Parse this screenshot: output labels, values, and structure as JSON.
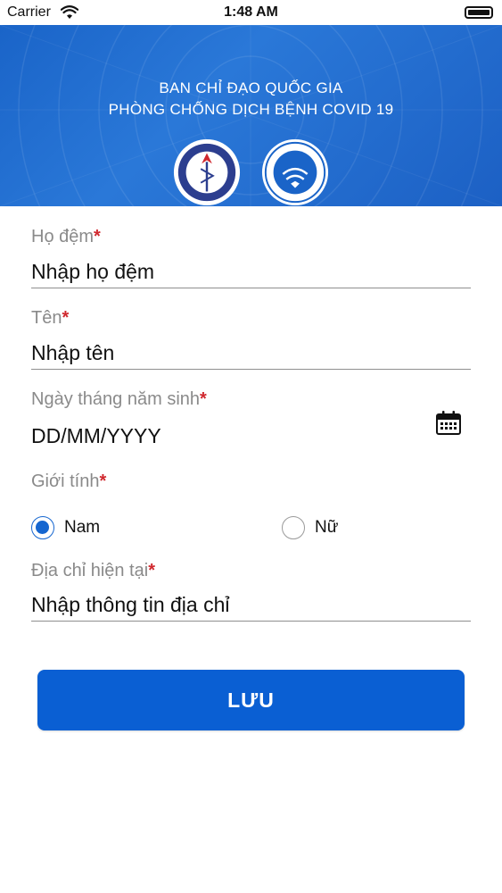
{
  "status_bar": {
    "carrier": "Carrier",
    "time": "1:48 AM"
  },
  "header": {
    "line1": "BAN CHỈ ĐẠO QUỐC GIA",
    "line2": "PHÒNG CHỐNG DỊCH BỆNH COVID 19",
    "background_color": "#1a64c8",
    "logos": [
      "ministry-of-health-logo",
      "ministry-of-information-logo"
    ]
  },
  "form": {
    "last_name": {
      "label": "Họ đệm",
      "required_mark": "*",
      "placeholder": "Nhập họ đệm",
      "value": ""
    },
    "first_name": {
      "label": "Tên",
      "required_mark": "*",
      "placeholder": "Nhập tên",
      "value": ""
    },
    "birth_date": {
      "label": "Ngày tháng năm sinh",
      "required_mark": "*",
      "placeholder": "DD/MM/YYYY",
      "value": "",
      "icon": "calendar-icon"
    },
    "gender": {
      "label": "Giới tính",
      "required_mark": "*",
      "options": [
        {
          "label": "Nam",
          "selected": true
        },
        {
          "label": "Nữ",
          "selected": false
        }
      ]
    },
    "address": {
      "label": "Địa chỉ hiện tại",
      "required_mark": "*",
      "placeholder": "Nhập thông tin địa chỉ",
      "value": ""
    }
  },
  "save_button": {
    "label": "LƯU",
    "color": "#0a5fd3"
  },
  "colors": {
    "accent": "#1566d0",
    "required": "#d0282e",
    "label": "#8a8a8a"
  }
}
